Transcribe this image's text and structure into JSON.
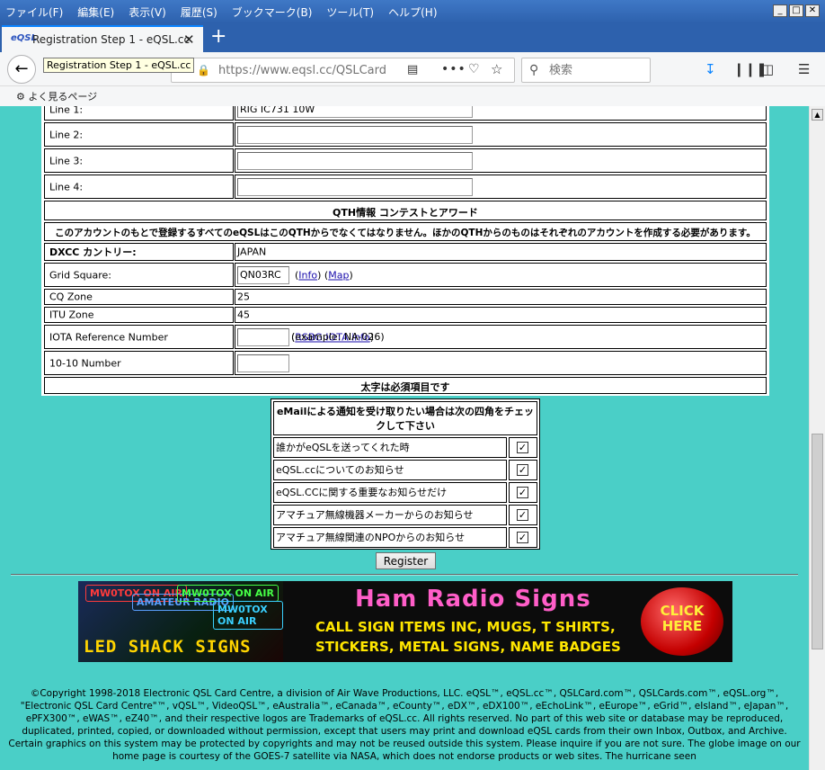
{
  "menubar": {
    "items": [
      "ファイル(F)",
      "編集(E)",
      "表示(V)",
      "履歴(S)",
      "ブックマーク(B)",
      "ツール(T)",
      "ヘルプ(H)"
    ]
  },
  "window_controls": {
    "minimize": "_",
    "maximize": "□",
    "close": "✕"
  },
  "tab": {
    "favicon_text": "eQSL",
    "title": "Registration Step 1 - eQSL.cc",
    "close": "✕",
    "new": "+"
  },
  "nav": {
    "back": "←",
    "tooltip": "Registration Step 1 - eQSL.cc",
    "url": "https://www.eqsl.cc/QSLCard",
    "search_placeholder": "検索"
  },
  "bookmarks": {
    "item": "よく見るページ"
  },
  "form": {
    "equipment": [
      {
        "label": "Line 1:",
        "value": "RIG IC731 10W"
      },
      {
        "label": "Line 2:",
        "value": ""
      },
      {
        "label": "Line 3:",
        "value": ""
      },
      {
        "label": "Line 4:",
        "value": ""
      }
    ],
    "qth_header": "QTH情報 コンテストとアワード",
    "qth_notice": "このアカウントのもとで登録するすべてのeQSLはこのQTHからでなくてはなりません。ほかのQTHからのものはそれぞれのアカウントを作成する必要があります。",
    "dxcc": {
      "label": "DXCC カントリー:",
      "value": "JAPAN"
    },
    "grid": {
      "label": "Grid Square:",
      "value": "QN03RC",
      "info": "Info",
      "map": "Map"
    },
    "cq": {
      "label": "CQ Zone",
      "value": "25"
    },
    "itu": {
      "label": "ITU Zone",
      "value": "45"
    },
    "iota": {
      "label": "IOTA Reference Number",
      "value": "",
      "example": "(example: NA-026)",
      "link": "RSBG IOTA info"
    },
    "ten_ten": {
      "label": "10-10 Number",
      "value": ""
    },
    "required_note": "太字は必須項目です"
  },
  "email": {
    "header": "eMailによる通知を受け取りたい場合は次の四角をチェックして下さい",
    "options": [
      {
        "label": "誰かがeQSLを送ってくれた時",
        "checked": true
      },
      {
        "label": "eQSL.ccについてのお知らせ",
        "checked": true
      },
      {
        "label": "eQSL.CCに関する重要なお知らせだけ",
        "checked": true
      },
      {
        "label": "アマチュア無線機器メーカーからのお知らせ",
        "checked": true
      },
      {
        "label": "アマチュア無線関連のNPOからのお知らせ",
        "checked": true
      }
    ],
    "checkmark": "✓"
  },
  "register_label": "Register",
  "banner": {
    "signs": [
      "MW0TOX ON AIR",
      "AMATEUR RADIO",
      "MW0TOX ON AIR",
      "MW0TOX ON AIR"
    ],
    "led_text": "LED SHACK SIGNS",
    "title": "Ham Radio Signs",
    "line1": "CALL SIGN ITEMS INC, MUGS, T SHIRTS,",
    "line2": "STICKERS, METAL SIGNS, NAME BADGES",
    "cta": "CLICK HERE"
  },
  "footer": "©Copyright 1998-2018 Electronic QSL Card Centre, a division of Air Wave Productions, LLC. eQSL™, eQSL.cc™, QSLCard.com™, QSLCards.com™, eQSL.org™, \"Electronic QSL Card Centre\"™, vQSL™, VideoQSL™, eAustralia™, eCanada™, eCounty™, eDX™, eDX100™, eEchoLink™, eEurope™, eGrid™, eIsland™, eJapan™, ePFX300™, eWAS™, eZ40™, and their respective logos are Trademarks of eQSL.cc. All rights reserved. No part of this web site or database may be reproduced, duplicated, printed, copied, or downloaded without permission, except that users may print and download eQSL cards from their own Inbox, Outbox, and Archive. Certain graphics on this system may be protected by copyrights and may not be reused outside this system. Please inquire if you are not sure. The globe image on our home page is courtesy of the GOES-7 satellite via NASA, which does not endorse products or web sites. The hurricane seen"
}
